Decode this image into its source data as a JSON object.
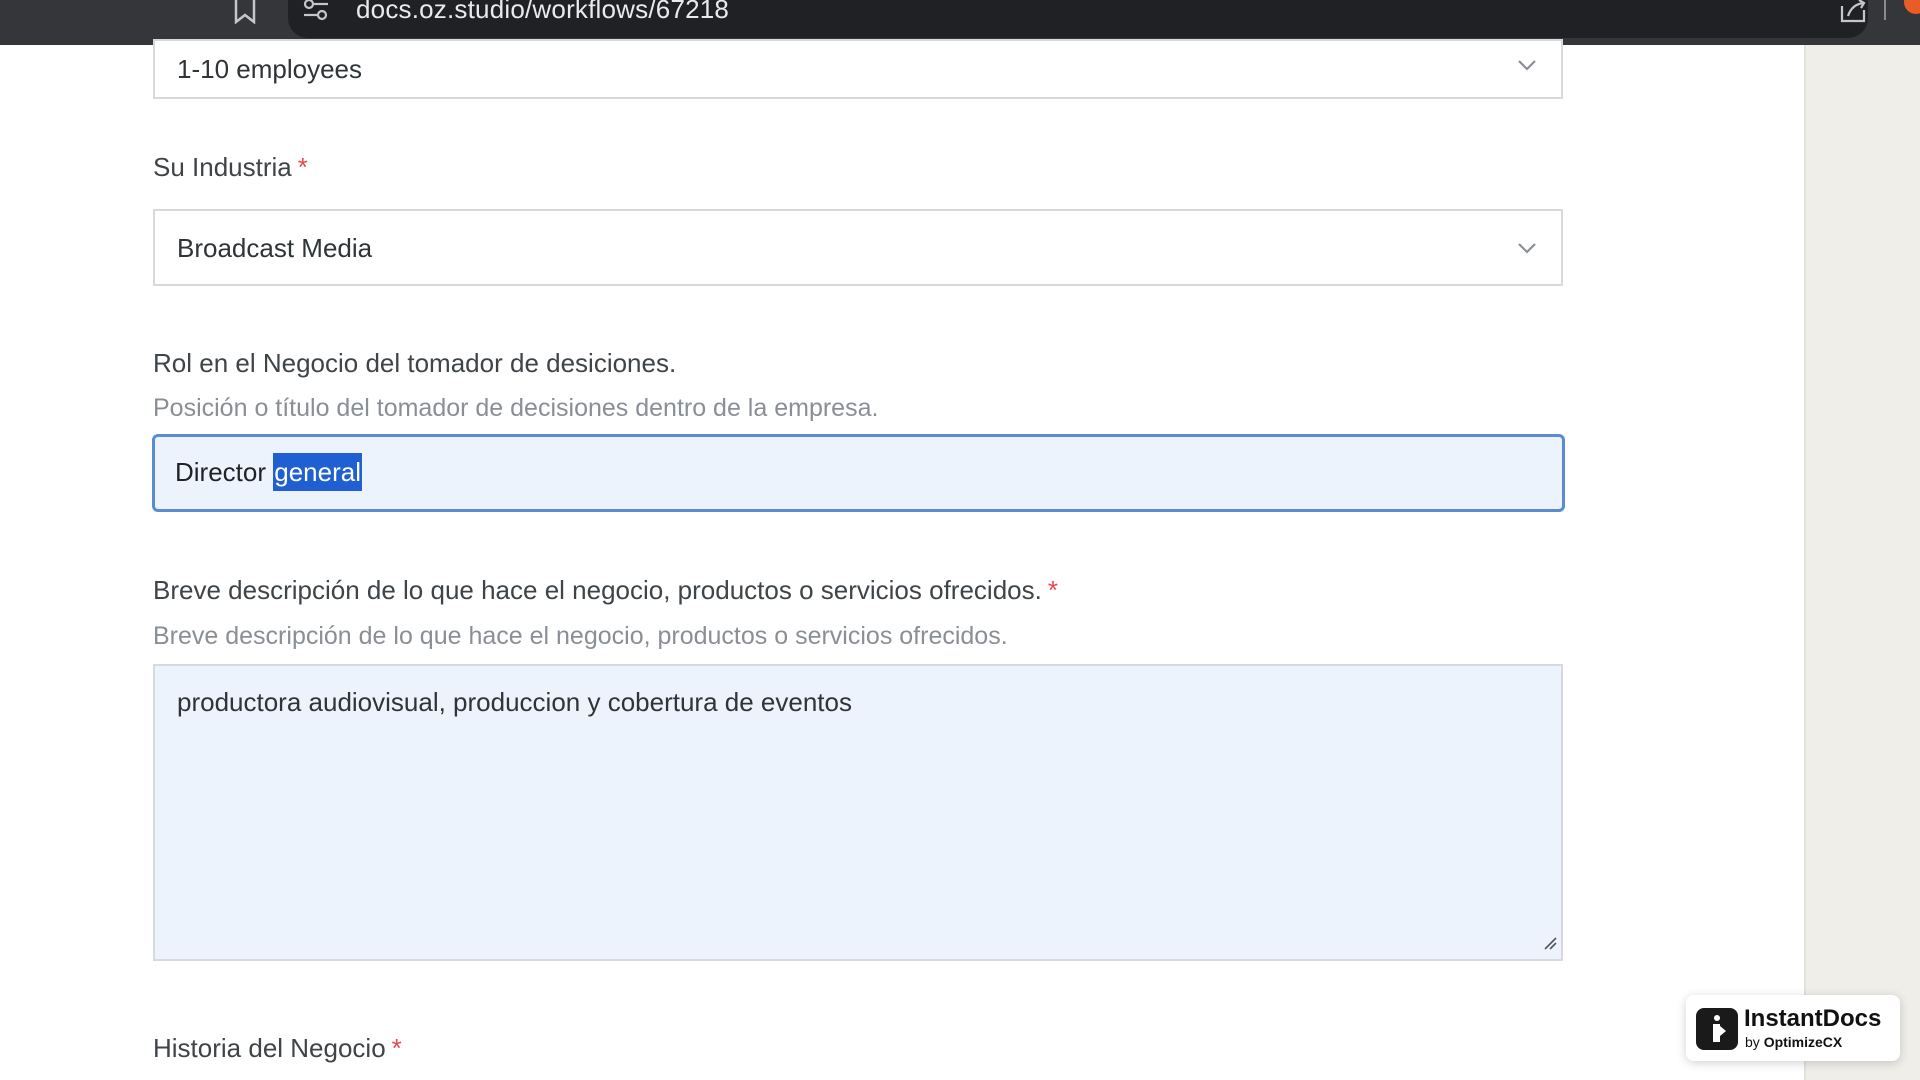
{
  "browser": {
    "url": "docs.oz.studio/workflows/67218"
  },
  "form": {
    "company_size": {
      "value": "1-10 employees"
    },
    "industry": {
      "label": "Su Industria",
      "required_mark": "*",
      "value": "Broadcast Media"
    },
    "role": {
      "label": "Rol en el Negocio del tomador de desiciones.",
      "help": "Posición o título del tomador de decisiones dentro de la empresa.",
      "value_unselected": "Director ",
      "value_selected": "general"
    },
    "description": {
      "label": "Breve descripción de lo que hace el negocio, productos o servicios ofrecidos.",
      "required_mark": "*",
      "help": "Breve descripción de lo que hace el negocio, productos o servicios ofrecidos.",
      "value": "productora audiovisual, produccion y cobertura de eventos"
    },
    "history": {
      "label": "Historia del Negocio",
      "required_mark": "*"
    }
  },
  "badge": {
    "name": "InstantDocs",
    "by_prefix": "by ",
    "by_brand": "OptimizeCX"
  },
  "colors": {
    "focus_border": "#5b8bd0",
    "selection": "#1f5fd1",
    "required": "#e5484d",
    "chrome_bg": "#35363a"
  }
}
